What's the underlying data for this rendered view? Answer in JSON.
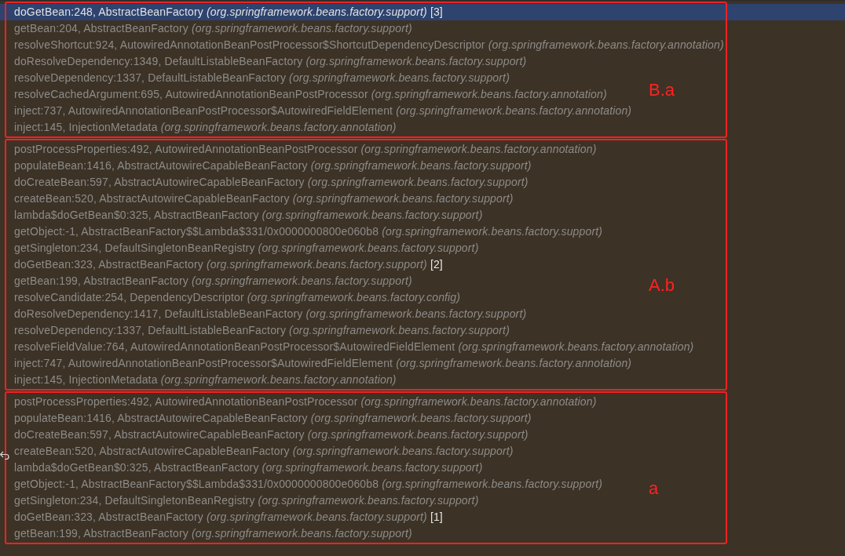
{
  "groups": [
    {
      "label": "B.a",
      "frames": [
        {
          "name": "doGetBean:248, AbstractBeanFactory",
          "package": "(org.springframework.beans.factory.support)",
          "marker": "[3]",
          "selected": true
        },
        {
          "name": "getBean:204, AbstractBeanFactory",
          "package": "(org.springframework.beans.factory.support)",
          "selected": false
        },
        {
          "name": "resolveShortcut:924, AutowiredAnnotationBeanPostProcessor$ShortcutDependencyDescriptor",
          "package": "(org.springframework.beans.factory.annotation)",
          "selected": false
        },
        {
          "name": "doResolveDependency:1349, DefaultListableBeanFactory",
          "package": "(org.springframework.beans.factory.support)",
          "selected": false
        },
        {
          "name": "resolveDependency:1337, DefaultListableBeanFactory",
          "package": "(org.springframework.beans.factory.support)",
          "selected": false
        },
        {
          "name": "resolveCachedArgument:695, AutowiredAnnotationBeanPostProcessor",
          "package": "(org.springframework.beans.factory.annotation)",
          "selected": false
        },
        {
          "name": "inject:737, AutowiredAnnotationBeanPostProcessor$AutowiredFieldElement",
          "package": "(org.springframework.beans.factory.annotation)",
          "selected": false
        },
        {
          "name": "inject:145, InjectionMetadata",
          "package": "(org.springframework.beans.factory.annotation)",
          "selected": false
        }
      ]
    },
    {
      "label": "A.b",
      "frames": [
        {
          "name": "postProcessProperties:492, AutowiredAnnotationBeanPostProcessor",
          "package": "(org.springframework.beans.factory.annotation)",
          "selected": false
        },
        {
          "name": "populateBean:1416, AbstractAutowireCapableBeanFactory",
          "package": "(org.springframework.beans.factory.support)",
          "selected": false
        },
        {
          "name": "doCreateBean:597, AbstractAutowireCapableBeanFactory",
          "package": "(org.springframework.beans.factory.support)",
          "selected": false
        },
        {
          "name": "createBean:520, AbstractAutowireCapableBeanFactory",
          "package": "(org.springframework.beans.factory.support)",
          "selected": false
        },
        {
          "name": "lambda$doGetBean$0:325, AbstractBeanFactory",
          "package": "(org.springframework.beans.factory.support)",
          "selected": false
        },
        {
          "name": "getObject:-1, AbstractBeanFactory$$Lambda$331/0x0000000800e060b8",
          "package": "(org.springframework.beans.factory.support)",
          "selected": false
        },
        {
          "name": "getSingleton:234, DefaultSingletonBeanRegistry",
          "package": "(org.springframework.beans.factory.support)",
          "selected": false
        },
        {
          "name": "doGetBean:323, AbstractBeanFactory",
          "package": "(org.springframework.beans.factory.support)",
          "marker": "[2]",
          "selected": false
        },
        {
          "name": "getBean:199, AbstractBeanFactory",
          "package": "(org.springframework.beans.factory.support)",
          "selected": false
        },
        {
          "name": "resolveCandidate:254, DependencyDescriptor",
          "package": "(org.springframework.beans.factory.config)",
          "selected": false
        },
        {
          "name": "doResolveDependency:1417, DefaultListableBeanFactory",
          "package": "(org.springframework.beans.factory.support)",
          "selected": false
        },
        {
          "name": "resolveDependency:1337, DefaultListableBeanFactory",
          "package": "(org.springframework.beans.factory.support)",
          "selected": false
        },
        {
          "name": "resolveFieldValue:764, AutowiredAnnotationBeanPostProcessor$AutowiredFieldElement",
          "package": "(org.springframework.beans.factory.annotation)",
          "selected": false
        },
        {
          "name": "inject:747, AutowiredAnnotationBeanPostProcessor$AutowiredFieldElement",
          "package": "(org.springframework.beans.factory.annotation)",
          "selected": false
        },
        {
          "name": "inject:145, InjectionMetadata",
          "package": "(org.springframework.beans.factory.annotation)",
          "selected": false
        }
      ]
    },
    {
      "label": "a",
      "frames": [
        {
          "name": "postProcessProperties:492, AutowiredAnnotationBeanPostProcessor",
          "package": "(org.springframework.beans.factory.annotation)",
          "selected": false
        },
        {
          "name": "populateBean:1416, AbstractAutowireCapableBeanFactory",
          "package": "(org.springframework.beans.factory.support)",
          "selected": false
        },
        {
          "name": "doCreateBean:597, AbstractAutowireCapableBeanFactory",
          "package": "(org.springframework.beans.factory.support)",
          "selected": false
        },
        {
          "name": "createBean:520, AbstractAutowireCapableBeanFactory",
          "package": "(org.springframework.beans.factory.support)",
          "selected": false
        },
        {
          "name": "lambda$doGetBean$0:325, AbstractBeanFactory",
          "package": "(org.springframework.beans.factory.support)",
          "selected": false
        },
        {
          "name": "getObject:-1, AbstractBeanFactory$$Lambda$331/0x0000000800e060b8",
          "package": "(org.springframework.beans.factory.support)",
          "selected": false
        },
        {
          "name": "getSingleton:234, DefaultSingletonBeanRegistry",
          "package": "(org.springframework.beans.factory.support)",
          "selected": false
        },
        {
          "name": "doGetBean:323, AbstractBeanFactory",
          "package": "(org.springframework.beans.factory.support)",
          "marker": "[1]",
          "selected": false
        },
        {
          "name": "getBean:199, AbstractBeanFactory",
          "package": "(org.springframework.beans.factory.support)",
          "selected": false
        }
      ]
    }
  ]
}
